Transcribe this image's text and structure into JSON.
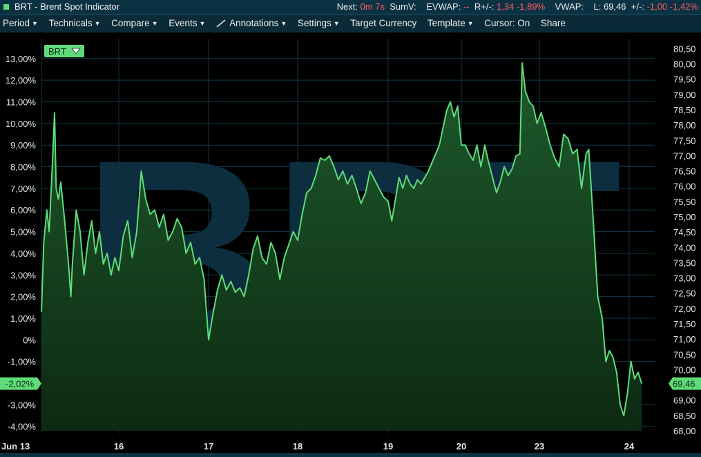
{
  "window": {
    "title": "BRT - Brent Spot Indicator"
  },
  "header_stats": {
    "next_label": "Next:",
    "next_value": "0m 7s",
    "sumv_label": "SumV:",
    "evwap_label": "EVWAP:",
    "evwap_value": "--",
    "rchg_label": "R+/-:",
    "rchg_value": "1,34",
    "rchg_pct": "-1,89%",
    "vwap_label": "VWAP:",
    "last_label": "L:",
    "last_value": "69,46",
    "chg_label": "+/-:",
    "chg_value": "-1,00",
    "chg_pct": "-1,42%"
  },
  "menu": {
    "period": "Period",
    "technicals": "Technicals",
    "compare": "Compare",
    "events": "Events",
    "annotations": "Annotations",
    "settings": "Settings",
    "target_currency": "Target Currency",
    "template": "Template",
    "cursor": "Cursor: On",
    "share": "Share"
  },
  "colors": {
    "line": "#5fdc7a",
    "area_top": "#1e5a2c",
    "area_bottom": "#0d2a12",
    "grid": "#103848",
    "badge": "#5fdc7a",
    "watermark": "#0c2e3f",
    "background": "#000000"
  },
  "chart": {
    "symbol_badge": "BRT",
    "watermark": "BRT",
    "current_pct_label": "-2,02%",
    "current_price_label": "69,46"
  },
  "chart_data": {
    "type": "area",
    "x_tick_labels": [
      "Jun 13",
      "16",
      "17",
      "18",
      "19",
      "20",
      "23",
      "24"
    ],
    "y_left_ticks": [
      "13,00%",
      "12,00%",
      "11,00%",
      "10,00%",
      "9,00%",
      "8,00%",
      "7,00%",
      "6,00%",
      "5,00%",
      "4,00%",
      "3,00%",
      "2,00%",
      "1,00%",
      "0%",
      "-1,00%",
      "-3,00%",
      "-4,00%"
    ],
    "y_left_values": [
      13,
      12,
      11,
      10,
      9,
      8,
      7,
      6,
      5,
      4,
      3,
      2,
      1,
      0,
      -1,
      -3,
      -4
    ],
    "y_right_ticks": [
      "80,50",
      "80,00",
      "79,50",
      "79,00",
      "78,50",
      "78,00",
      "77,50",
      "77,00",
      "76,50",
      "76,00",
      "75,50",
      "75,00",
      "74,50",
      "74,00",
      "73,50",
      "73,00",
      "72,50",
      "72,00",
      "71,50",
      "71,00",
      "70,50",
      "70,00",
      "69,00",
      "68,50",
      "68,00"
    ],
    "y_right_values": [
      80.5,
      80.0,
      79.5,
      79.0,
      78.5,
      78.0,
      77.5,
      77.0,
      76.5,
      76.0,
      75.5,
      75.0,
      74.5,
      74.0,
      73.5,
      73.0,
      72.5,
      72.0,
      71.5,
      71.0,
      70.5,
      70.0,
      69.0,
      68.5,
      68.0
    ],
    "pct_range": [
      -4.2,
      13.6
    ],
    "price_range": [
      68.0,
      80.6
    ],
    "x_range": [
      0,
      7.3
    ],
    "series": [
      {
        "values_pct": [
          [
            0,
            1.3
          ],
          [
            0.03,
            4.5
          ],
          [
            0.07,
            6.0
          ],
          [
            0.1,
            5.0
          ],
          [
            0.14,
            8.0
          ],
          [
            0.17,
            10.5
          ],
          [
            0.19,
            7.0
          ],
          [
            0.22,
            6.5
          ],
          [
            0.25,
            7.3
          ],
          [
            0.3,
            5.5
          ],
          [
            0.35,
            3.5
          ],
          [
            0.38,
            2.0
          ],
          [
            0.4,
            3.5
          ],
          [
            0.45,
            6.0
          ],
          [
            0.5,
            5.0
          ],
          [
            0.55,
            3.0
          ],
          [
            0.6,
            4.5
          ],
          [
            0.65,
            5.5
          ],
          [
            0.7,
            4.0
          ],
          [
            0.75,
            5.0
          ],
          [
            0.8,
            3.5
          ],
          [
            0.85,
            4.0
          ],
          [
            0.9,
            3.0
          ],
          [
            0.95,
            3.8
          ],
          [
            1.0,
            3.2
          ],
          [
            1.05,
            4.8
          ],
          [
            1.1,
            5.5
          ],
          [
            1.15,
            3.8
          ],
          [
            1.2,
            5.0
          ],
          [
            1.25,
            7.8
          ],
          [
            1.3,
            6.5
          ],
          [
            1.35,
            5.8
          ],
          [
            1.4,
            6.0
          ],
          [
            1.45,
            5.2
          ],
          [
            1.5,
            5.8
          ],
          [
            1.55,
            4.6
          ],
          [
            1.6,
            5.0
          ],
          [
            1.65,
            5.6
          ],
          [
            1.7,
            5.2
          ],
          [
            1.75,
            4.0
          ],
          [
            1.8,
            4.5
          ],
          [
            1.85,
            3.5
          ],
          [
            1.9,
            3.8
          ],
          [
            1.95,
            2.8
          ],
          [
            2.0,
            0.0
          ],
          [
            2.05,
            1.2
          ],
          [
            2.1,
            2.3
          ],
          [
            2.15,
            3.0
          ],
          [
            2.2,
            2.3
          ],
          [
            2.25,
            2.7
          ],
          [
            2.3,
            2.2
          ],
          [
            2.35,
            2.4
          ],
          [
            2.4,
            2.0
          ],
          [
            2.45,
            3.0
          ],
          [
            2.5,
            4.2
          ],
          [
            2.55,
            4.8
          ],
          [
            2.6,
            3.8
          ],
          [
            2.65,
            3.5
          ],
          [
            2.7,
            4.5
          ],
          [
            2.75,
            4.0
          ],
          [
            2.8,
            2.8
          ],
          [
            2.85,
            3.8
          ],
          [
            2.9,
            4.4
          ],
          [
            2.95,
            5.0
          ],
          [
            3.0,
            4.6
          ],
          [
            3.05,
            5.8
          ],
          [
            3.1,
            6.8
          ],
          [
            3.15,
            7.0
          ],
          [
            3.2,
            7.6
          ],
          [
            3.25,
            8.4
          ],
          [
            3.3,
            8.3
          ],
          [
            3.35,
            8.5
          ],
          [
            3.4,
            8.0
          ],
          [
            3.45,
            7.4
          ],
          [
            3.5,
            7.8
          ],
          [
            3.55,
            7.2
          ],
          [
            3.6,
            7.6
          ],
          [
            3.65,
            7.0
          ],
          [
            3.7,
            6.3
          ],
          [
            3.75,
            6.8
          ],
          [
            3.8,
            7.8
          ],
          [
            3.85,
            7.4
          ],
          [
            3.9,
            7.0
          ],
          [
            3.95,
            6.6
          ],
          [
            4.0,
            6.4
          ],
          [
            4.05,
            5.5
          ],
          [
            4.1,
            6.5
          ],
          [
            4.15,
            7.5
          ],
          [
            4.2,
            7.0
          ],
          [
            4.25,
            7.6
          ],
          [
            4.3,
            7.2
          ],
          [
            4.35,
            7.0
          ],
          [
            4.4,
            7.4
          ],
          [
            4.45,
            7.2
          ],
          [
            4.5,
            7.5
          ],
          [
            4.55,
            7.8
          ],
          [
            4.6,
            8.2
          ],
          [
            4.65,
            8.6
          ],
          [
            4.7,
            9.0
          ],
          [
            4.75,
            9.8
          ],
          [
            4.8,
            10.6
          ],
          [
            4.85,
            11.0
          ],
          [
            4.9,
            10.3
          ],
          [
            4.95,
            10.8
          ],
          [
            5.0,
            9.0
          ],
          [
            5.05,
            9.0
          ],
          [
            5.1,
            8.6
          ],
          [
            5.15,
            8.3
          ],
          [
            5.2,
            9.0
          ],
          [
            5.25,
            8.0
          ],
          [
            5.3,
            9.0
          ],
          [
            5.35,
            8.2
          ],
          [
            5.4,
            7.5
          ],
          [
            5.45,
            6.8
          ],
          [
            5.5,
            7.3
          ],
          [
            5.55,
            8.0
          ],
          [
            5.6,
            7.6
          ],
          [
            5.65,
            7.9
          ],
          [
            5.7,
            8.5
          ],
          [
            5.75,
            8.6
          ],
          [
            5.78,
            12.8
          ],
          [
            5.82,
            11.5
          ],
          [
            5.87,
            11.0
          ],
          [
            5.92,
            10.8
          ],
          [
            5.97,
            10.0
          ],
          [
            6.02,
            10.5
          ],
          [
            6.07,
            9.8
          ],
          [
            6.12,
            9.0
          ],
          [
            6.17,
            8.4
          ],
          [
            6.22,
            8.0
          ],
          [
            6.27,
            9.5
          ],
          [
            6.32,
            9.3
          ],
          [
            6.37,
            8.6
          ],
          [
            6.42,
            8.8
          ],
          [
            6.47,
            7.0
          ],
          [
            6.52,
            8.6
          ],
          [
            6.55,
            8.8
          ],
          [
            6.6,
            5.5
          ],
          [
            6.65,
            2.0
          ],
          [
            6.7,
            1.0
          ],
          [
            6.74,
            -1.0
          ],
          [
            6.78,
            -0.5
          ],
          [
            6.82,
            -0.8
          ],
          [
            6.86,
            -1.5
          ],
          [
            6.9,
            -3.0
          ],
          [
            6.94,
            -3.5
          ],
          [
            6.98,
            -2.5
          ],
          [
            7.02,
            -1.0
          ],
          [
            7.06,
            -1.8
          ],
          [
            7.1,
            -1.5
          ],
          [
            7.14,
            -2.02
          ]
        ]
      }
    ]
  }
}
